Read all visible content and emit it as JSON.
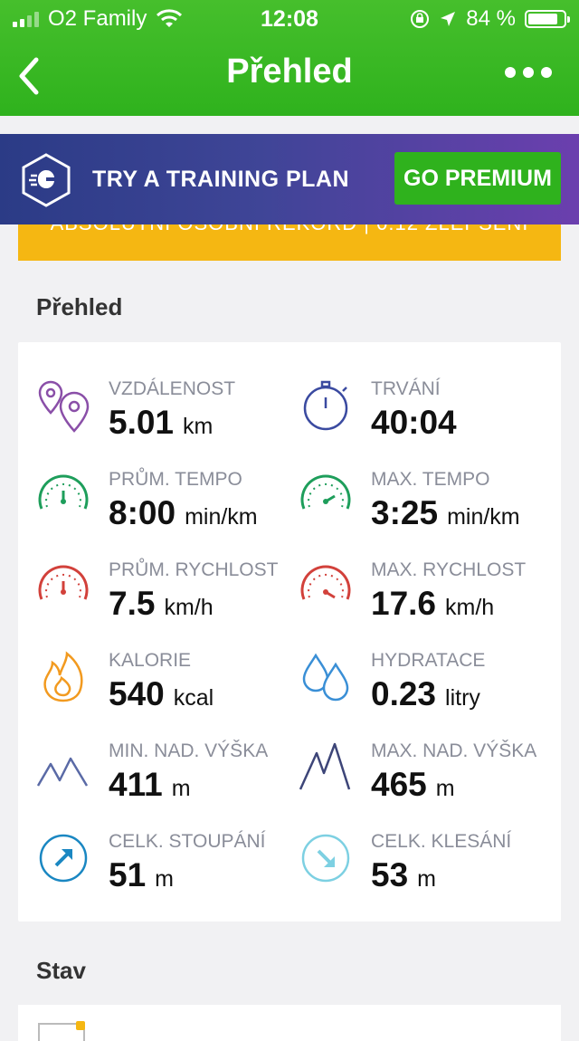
{
  "status_bar": {
    "carrier": "O2 Family",
    "time": "12:08",
    "battery": "84 %",
    "battery_level": 0.84
  },
  "header": {
    "title": "Přehled"
  },
  "banner": {
    "text": "TRY A TRAINING PLAN",
    "button": "GO PREMIUM"
  },
  "record_strip": {
    "text": "ABSOLUTNÍ OSOBNÍ REKORD | 0:12 ZLEPŠENÍ"
  },
  "overview": {
    "title": "Přehled",
    "metrics": [
      {
        "label": "VZDÁLENOST",
        "value": "5.01",
        "unit": "km"
      },
      {
        "label": "TRVÁNÍ",
        "value": "40:04",
        "unit": ""
      },
      {
        "label": "PRŮM. TEMPO",
        "value": "8:00",
        "unit": "min/km"
      },
      {
        "label": "MAX. TEMPO",
        "value": "3:25",
        "unit": "min/km"
      },
      {
        "label": "PRŮM. RYCHLOST",
        "value": "7.5",
        "unit": "km/h"
      },
      {
        "label": "MAX. RYCHLOST",
        "value": "17.6",
        "unit": "km/h"
      },
      {
        "label": "KALORIE",
        "value": "540",
        "unit": "kcal"
      },
      {
        "label": "HYDRATACE",
        "value": "0.23",
        "unit": "litry"
      },
      {
        "label": "MIN. NAD. VÝŠKA",
        "value": "411",
        "unit": "m"
      },
      {
        "label": "MAX. NAD. VÝŠKA",
        "value": "465",
        "unit": "m"
      },
      {
        "label": "CELK. STOUPÁNÍ",
        "value": "51",
        "unit": "m"
      },
      {
        "label": "CELK. KLESÁNÍ",
        "value": "53",
        "unit": "m"
      }
    ]
  },
  "status_section": {
    "title": "Stav"
  },
  "icons": {
    "distance": "location-pins-icon",
    "duration": "stopwatch-icon",
    "avg_pace": "gauge-icon",
    "max_pace": "gauge-icon",
    "avg_speed": "gauge-icon",
    "max_speed": "gauge-icon",
    "calories": "flame-icon",
    "hydration": "water-drops-icon",
    "min_elev": "mountains-icon",
    "max_elev": "mountains-icon",
    "ascent": "arrow-up-right-icon",
    "descent": "arrow-down-right-icon"
  },
  "colors": {
    "header_green": "#2fb21d",
    "premium_green": "#2fb21d",
    "record_yellow": "#f5b712",
    "pace_green": "#1e9e5b",
    "speed_red": "#d2413b",
    "calorie_orange": "#f29a1f",
    "hydration_blue": "#3a8fd6",
    "elevation_slate": "#5a6aa6",
    "ascent_blue": "#1a87c2",
    "descent_cyan": "#7dd0e2",
    "distance_purple": "#8a4fa8",
    "duration_navy": "#3a4aa0"
  }
}
